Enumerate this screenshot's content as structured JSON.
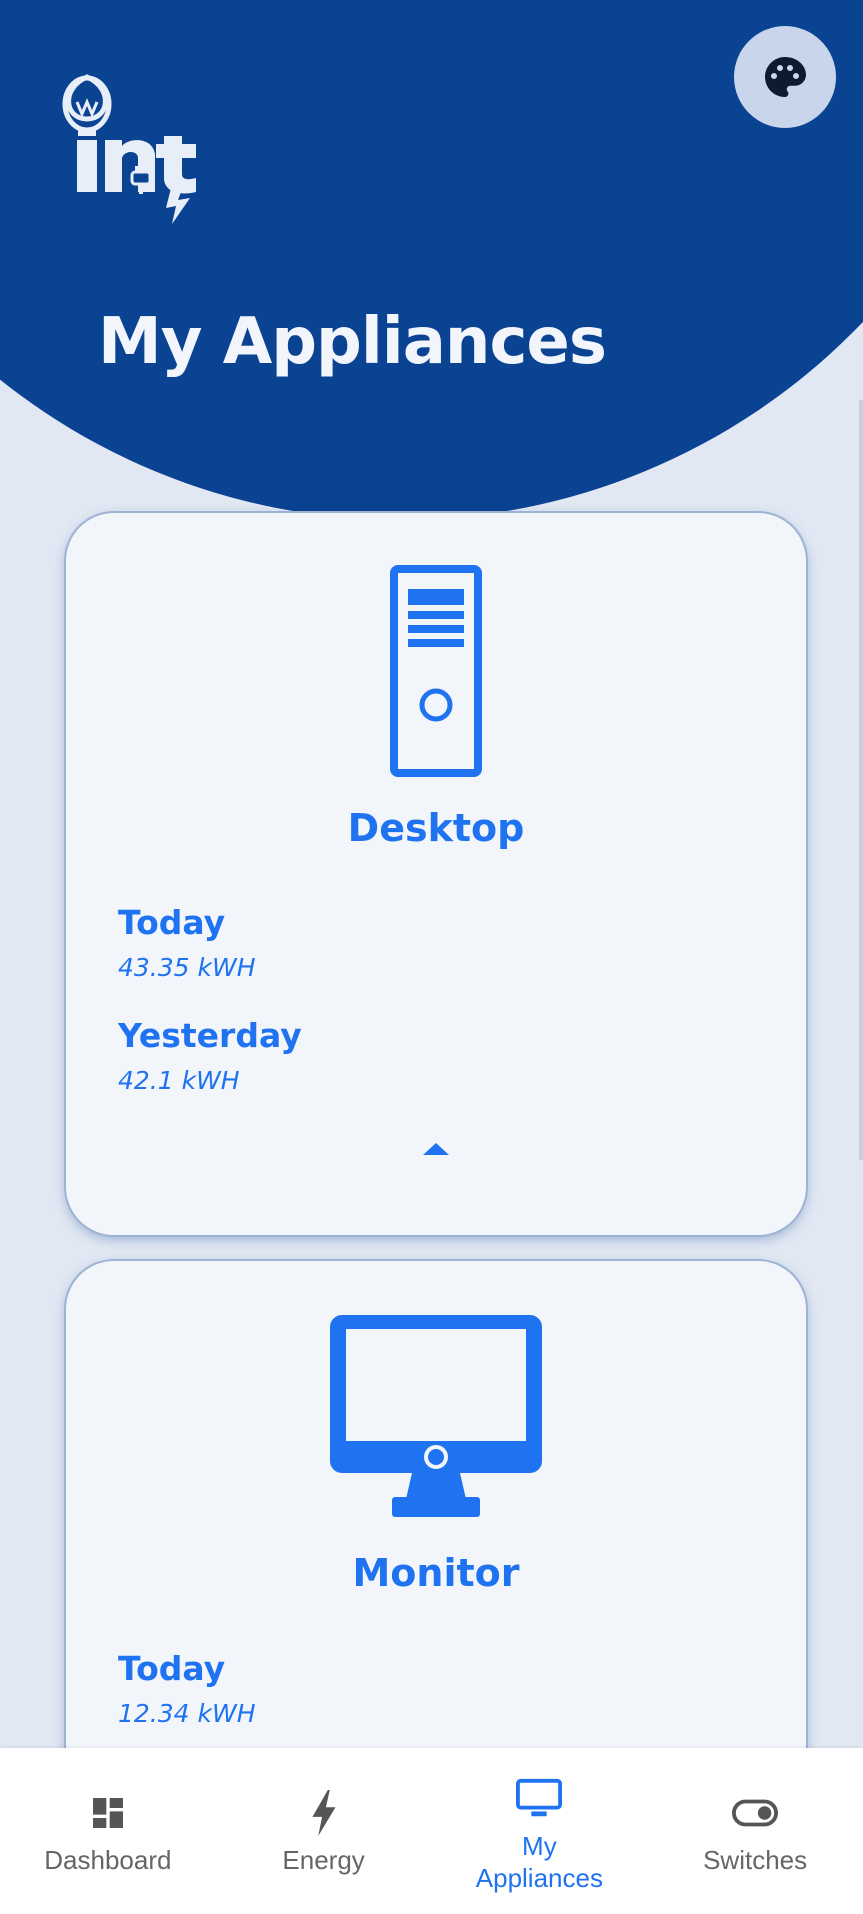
{
  "app": {
    "logo_text": "int",
    "title": "My Appliances",
    "theme_icon": "palette-icon"
  },
  "colors": {
    "primary_dark": "#0b4393",
    "accent_blue": "#1f73f0",
    "card_bg": "#f2f5f9",
    "page_bg": "#e1e8f3",
    "nav_inactive": "#666666"
  },
  "appliances": [
    {
      "name": "Desktop",
      "icon": "desktop-tower-icon",
      "today_label": "Today",
      "today_value": "43.35 kWH",
      "yesterday_label": "Yesterday",
      "yesterday_value": "42.1 kWH",
      "expanded": true
    },
    {
      "name": "Monitor",
      "icon": "monitor-icon",
      "today_label": "Today",
      "today_value": "12.34 kWH"
    }
  ],
  "bottom_nav": [
    {
      "label": "Dashboard",
      "icon": "dashboard-icon",
      "active": false
    },
    {
      "label": "Energy",
      "icon": "lightning-bolt-icon",
      "active": false
    },
    {
      "label": "My\nAppliances",
      "icon": "monitor-icon",
      "active": true
    },
    {
      "label": "Switches",
      "icon": "toggle-switch-icon",
      "active": false
    }
  ]
}
